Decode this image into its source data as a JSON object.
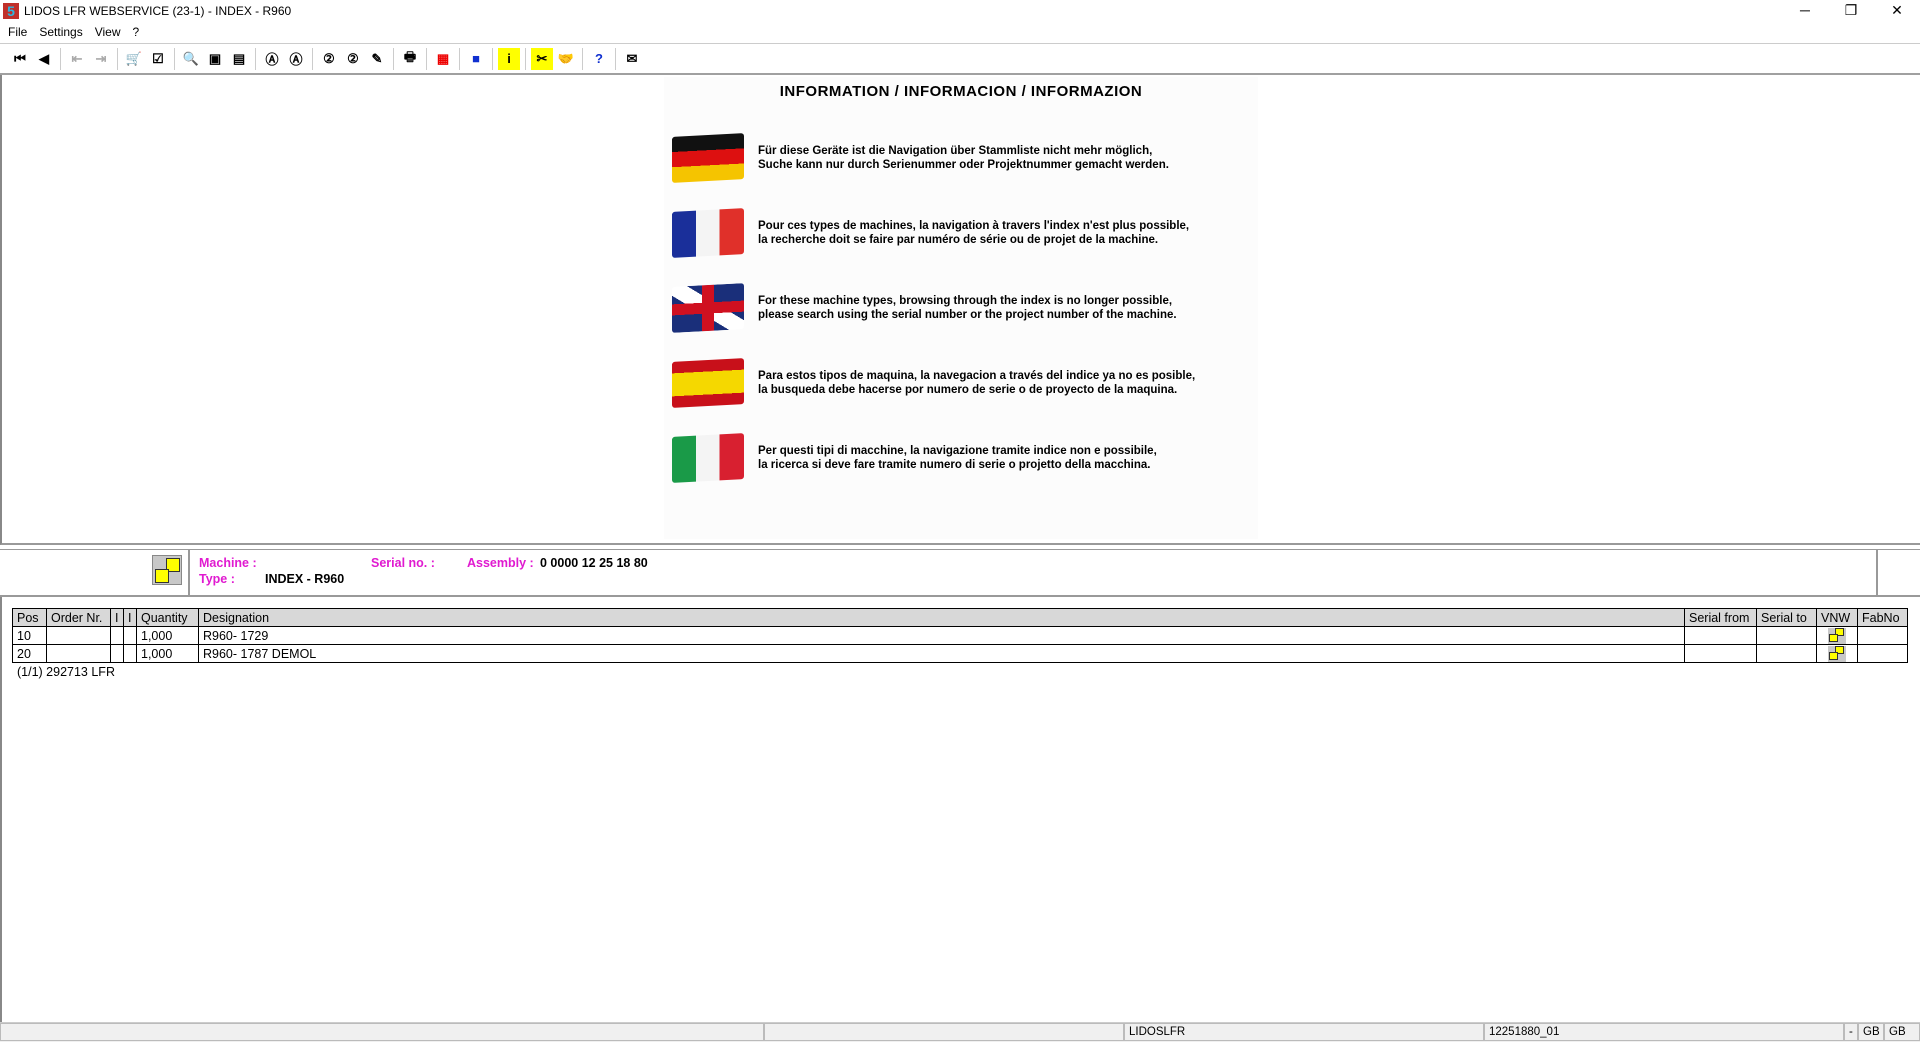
{
  "window": {
    "title": "LIDOS LFR WEBSERVICE (23-1) - INDEX - R960",
    "icon_text": "5",
    "min": "─",
    "max": "❐",
    "close": "✕"
  },
  "menu": [
    "File",
    "Settings",
    "View",
    "?"
  ],
  "toolbar": [
    {
      "name": "first-icon",
      "g": "⏮"
    },
    {
      "name": "prev-icon",
      "g": "◀"
    },
    {
      "sep": true
    },
    {
      "name": "back-doc-icon",
      "g": "⇤",
      "dim": true
    },
    {
      "name": "forward-doc-icon",
      "g": "⇥",
      "dim": true
    },
    {
      "sep": true
    },
    {
      "name": "cart-icon",
      "g": "🛒"
    },
    {
      "name": "checklist-icon",
      "g": "☑"
    },
    {
      "sep": true
    },
    {
      "name": "zoom-in-icon",
      "g": "🔍"
    },
    {
      "name": "page-icon",
      "g": "▣"
    },
    {
      "name": "page2-icon",
      "g": "▤"
    },
    {
      "sep": true
    },
    {
      "name": "search-a-icon",
      "g": "Ⓐ"
    },
    {
      "name": "search-a-back-icon",
      "g": "Ⓐ"
    },
    {
      "sep": true
    },
    {
      "name": "search-2-icon",
      "g": "②"
    },
    {
      "name": "search-2-back-icon",
      "g": "②"
    },
    {
      "name": "note-icon",
      "g": "✎"
    },
    {
      "sep": true
    },
    {
      "name": "print-icon",
      "g": "🖶"
    },
    {
      "sep": true
    },
    {
      "name": "grid-icon",
      "g": "▦",
      "c": "#e00"
    },
    {
      "sep": true
    },
    {
      "name": "eu-icon",
      "g": "■",
      "c": "#1030d0"
    },
    {
      "sep": true
    },
    {
      "name": "info-icon",
      "g": "i",
      "c": "#000",
      "bg": "#ff0"
    },
    {
      "sep": true
    },
    {
      "name": "tools-icon",
      "g": "✂",
      "bg": "#ff0"
    },
    {
      "name": "handshake-icon",
      "g": "🤝"
    },
    {
      "sep": true
    },
    {
      "name": "help-icon",
      "g": "?",
      "c": "#1030d0"
    },
    {
      "sep": true
    },
    {
      "name": "mail-icon",
      "g": "✉"
    }
  ],
  "info": {
    "title": "INFORMATION / INFORMACION / INFORMAZION",
    "langs": [
      {
        "flag": "de",
        "l1": "Für diese Geräte ist die Navigation über Stammliste nicht mehr möglich,",
        "l2": "Suche kann nur durch Serienummer oder Projektnummer gemacht werden."
      },
      {
        "flag": "fr",
        "l1": "Pour ces types de machines, la navigation à travers l'index n'est plus possible,",
        "l2": "la recherche doit se faire par numéro de série ou de projet de la machine."
      },
      {
        "flag": "gb",
        "l1": "For these machine types, browsing through the index is no longer possible,",
        "l2": "please search using the serial number or the project number of the machine."
      },
      {
        "flag": "es",
        "l1": "Para estos tipos de maquina, la navegacion a través del indice ya no es posible,",
        "l2": "la busqueda debe hacerse por numero de serie o de proyecto de la maquina."
      },
      {
        "flag": "it",
        "l1": "Per questi tipi di macchine, la navigazione tramite indice non e possibile,",
        "l2": "la ricerca si deve fare tramite numero di serie o projetto della macchina."
      }
    ]
  },
  "header": {
    "machine_label": "Machine :",
    "type_label": "Type :",
    "type_value": "INDEX - R960",
    "serial_label": "Serial no. :",
    "assembly_label": "Assembly :",
    "assembly_value": "0 0000 12 25 18 80"
  },
  "table": {
    "columns": [
      "Pos",
      "Order Nr.",
      "I",
      "I",
      "Quantity",
      "Designation",
      "Serial from",
      "Serial to",
      "VNW",
      "FabNo"
    ],
    "rows": [
      [
        "10",
        "",
        "",
        "",
        "1,000",
        "R960- 1729",
        "",
        "",
        "",
        ""
      ],
      [
        "20",
        "",
        "",
        "",
        "1,000",
        "R960- 1787 DEMOL",
        "",
        "",
        "",
        ""
      ]
    ]
  },
  "footer": "(1/1) 292713 LFR",
  "status": [
    "",
    "",
    "LIDOSLFR",
    "12251880_01",
    "-",
    "GB",
    "GB"
  ]
}
